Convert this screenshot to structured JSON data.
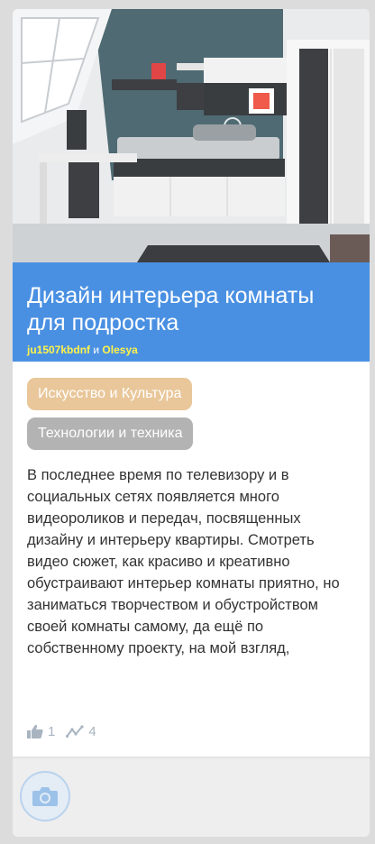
{
  "post": {
    "title": "Дизайн интерьера комнаты для подростка",
    "authors": [
      "ju1507kbdnf",
      "Olesya"
    ],
    "author_separator": "и",
    "tags": [
      {
        "label": "Искусство и Культура",
        "color": "#e9c79a"
      },
      {
        "label": "Технологии и техника",
        "color": "#b3b3b3"
      }
    ],
    "excerpt": "В последнее время по телевизору и в социальных сетях появляется много видеороликов и передач, посвященных дизайну и интерьеру квартиры. Смотреть видео сюжет, как красиво и креативно обустраивают интерьер комнаты приятно, но заниматься творчеством и обустройством своей комнаты самому, да ещё по собственному проекту, на мой взгляд,",
    "likes": "1",
    "reposts": "4"
  },
  "colors": {
    "title_band": "#4a90e2",
    "author_link": "#fff34a",
    "stats": "#a8b4c0"
  },
  "icons": {
    "like": "thumbs-up-icon",
    "repost": "trend-icon",
    "camera": "camera-icon"
  }
}
